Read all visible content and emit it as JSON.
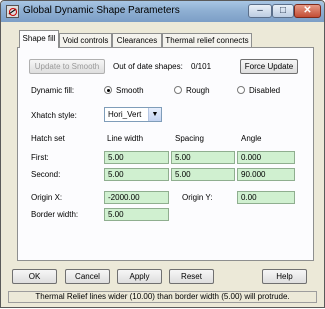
{
  "window": {
    "title": "Global Dynamic Shape Parameters"
  },
  "titlebar": {
    "minimize": "–",
    "maximize": "□",
    "close": "✕"
  },
  "tabs": [
    {
      "label": "Shape fill"
    },
    {
      "label": "Void controls"
    },
    {
      "label": "Clearances"
    },
    {
      "label": "Thermal relief connects"
    }
  ],
  "shape_fill": {
    "update_button": "Update to Smooth",
    "out_of_date_label": "Out of date shapes:",
    "out_of_date_value": "0/101",
    "force_update_button": "Force Update",
    "dynamic_fill_label": "Dynamic fill:",
    "fill_options": [
      "Smooth",
      "Rough",
      "Disabled"
    ],
    "fill_selected": "Smooth",
    "xhatch_label": "Xhatch style:",
    "xhatch_value": "Hori_Vert",
    "hatch_header": {
      "set": "Hatch set",
      "width": "Line width",
      "spacing": "Spacing",
      "angle": "Angle"
    },
    "hatch_rows": [
      {
        "label": "First:",
        "width": "5.00",
        "spacing": "5.00",
        "angle": "0.000"
      },
      {
        "label": "Second:",
        "width": "5.00",
        "spacing": "5.00",
        "angle": "90.000"
      }
    ],
    "origin_x_label": "Origin X:",
    "origin_x_value": "-2000.00",
    "origin_y_label": "Origin Y:",
    "origin_y_value": "0.00",
    "border_width_label": "Border width:",
    "border_width_value": "5.00"
  },
  "footer_buttons": {
    "ok": "OK",
    "cancel": "Cancel",
    "apply": "Apply",
    "reset": "Reset",
    "help": "Help"
  },
  "status": "Thermal Relief lines wider (10.00) than border width (5.00) will protrude."
}
